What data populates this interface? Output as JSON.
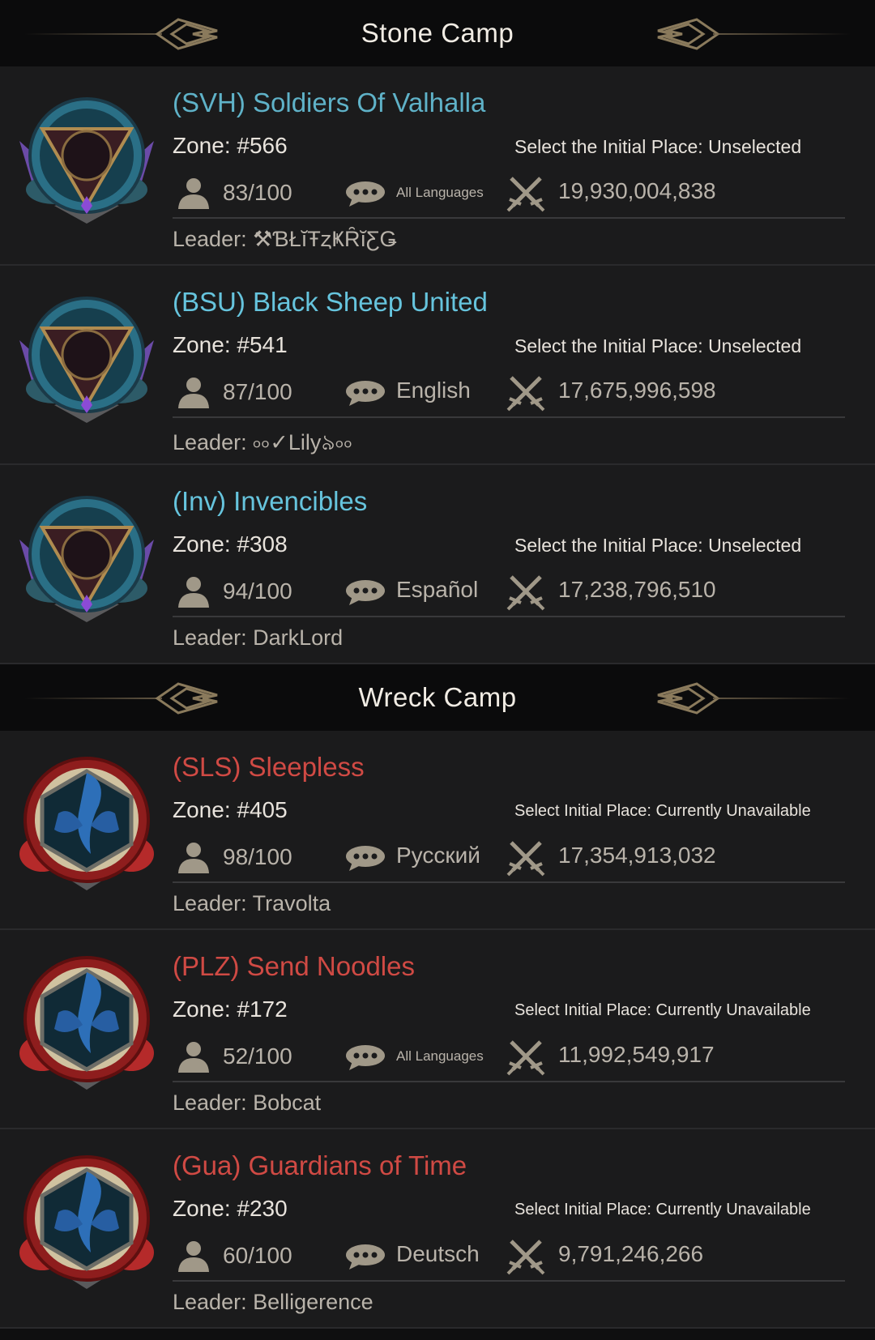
{
  "camps": [
    {
      "title": "Stone Camp",
      "guilds": [
        {
          "name": "(SVH) Soldiers Of Valhalla",
          "zone": "Zone: #566",
          "initial_place": "Select the Initial Place: Unselected",
          "members": "83/100",
          "language": "All Languages",
          "power": "19,930,004,838",
          "leader": "Leader: ⚒ƁŁĭŦȥҜȒĭƸǤ",
          "emblem": "dragonfly-emblem-icon"
        },
        {
          "name": "(BSU) Black Sheep United",
          "zone": "Zone: #541",
          "initial_place": "Select the Initial Place: Unselected",
          "members": "87/100",
          "language": "English",
          "power": "17,675,996,598",
          "leader": "Leader: ৹৹✓Lily৯৹৹",
          "emblem": "mantis-emblem-icon"
        },
        {
          "name": "(Inv) Invencibles",
          "zone": "Zone: #308",
          "initial_place": "Select the Initial Place: Unselected",
          "members": "94/100",
          "language": "Español",
          "power": "17,238,796,510",
          "leader": "Leader: DarkLord",
          "emblem": "flower-emblem-icon"
        }
      ]
    },
    {
      "title": "Wreck Camp",
      "guilds": [
        {
          "name": "(SLS) Sleepless",
          "zone": "Zone: #405",
          "initial_place": "Select Initial Place: Currently Unavailable",
          "members": "98/100",
          "language": "Русский",
          "power": "17,354,913,032",
          "leader": "Leader: Travolta",
          "emblem": "scorpion-emblem-icon"
        },
        {
          "name": "(PLZ) Send Noodles",
          "zone": "Zone: #172",
          "initial_place": "Select Initial Place: Currently Unavailable",
          "members": "52/100",
          "language": "All Languages",
          "power": "11,992,549,917",
          "leader": "Leader: Bobcat",
          "emblem": "scorpion-emblem-icon"
        },
        {
          "name": "(Gua) Guardians of Time",
          "zone": "Zone: #230",
          "initial_place": "Select Initial Place: Currently Unavailable",
          "members": "60/100",
          "language": "Deutsch",
          "power": "9,791,246,266",
          "leader": "Leader: Belligerence",
          "emblem": "scorpion-emblem-icon"
        }
      ]
    }
  ],
  "colors": {
    "stone_name": "#5fb2c8",
    "wreck_name": "#d04a44",
    "row_bg": "#1b1b1c",
    "header_bg": "#0b0b0c"
  },
  "icons": {
    "members": "person-icon",
    "language": "chat-bubble-icon",
    "power": "crossed-swords-icon"
  }
}
